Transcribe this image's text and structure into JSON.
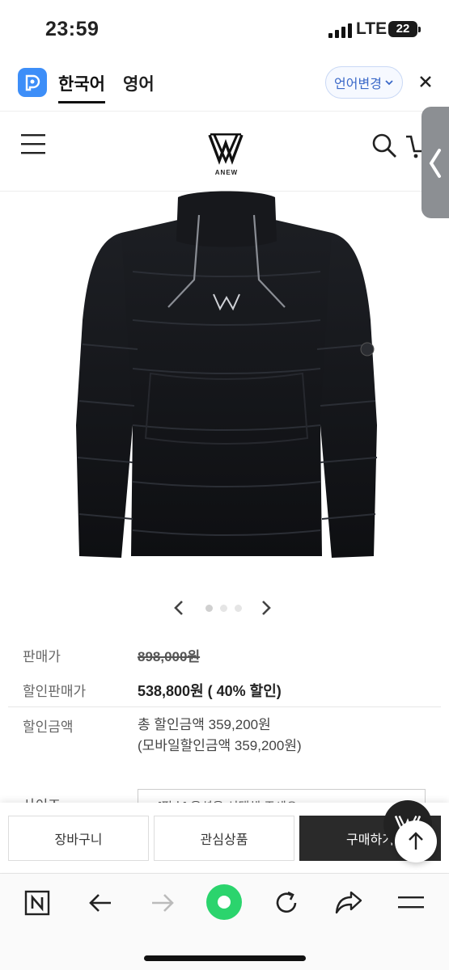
{
  "status_bar": {
    "time": "23:59",
    "network": "LTE",
    "battery": "22"
  },
  "translate_bar": {
    "tabs": [
      "한국어",
      "영어"
    ],
    "change_label": "언어변경",
    "icons": {
      "app": "papago-icon",
      "change": "chevron-down-icon",
      "close": "close-icon"
    }
  },
  "header": {
    "logo_text": "ANEW",
    "icons": {
      "menu": "hamburger-menu-icon",
      "search": "search-icon",
      "cart": "cart-icon",
      "side": "chevron-left-icon"
    }
  },
  "carousel": {
    "total_pages": 3,
    "current_page": 1
  },
  "price": {
    "list_label": "판매가",
    "list_value": "898,000원",
    "sale_label": "할인판매가",
    "sale_value": "538,800원 ( 40% 할인)",
    "discount_label": "할인금액",
    "discount_total": "총 할인금액 359,200원",
    "discount_mobile": "(모바일할인금액 359,200원)"
  },
  "options": {
    "size_label": "사이즈",
    "size_placeholder": "[필수] 옵션을 선택해 주세요"
  },
  "actions": {
    "cart": "장바구니",
    "wishlist": "관심상품",
    "buy": "구매하기"
  },
  "browser_toolbar": {
    "icons": [
      "naver-n-icon",
      "back-arrow-icon",
      "forward-arrow-icon",
      "green-home-icon",
      "refresh-icon",
      "share-icon",
      "menu-icon"
    ]
  },
  "colors": {
    "accent_blue": "#3a68c8",
    "buy_button": "#2a2a2a",
    "home_green": "#2bd46d"
  }
}
